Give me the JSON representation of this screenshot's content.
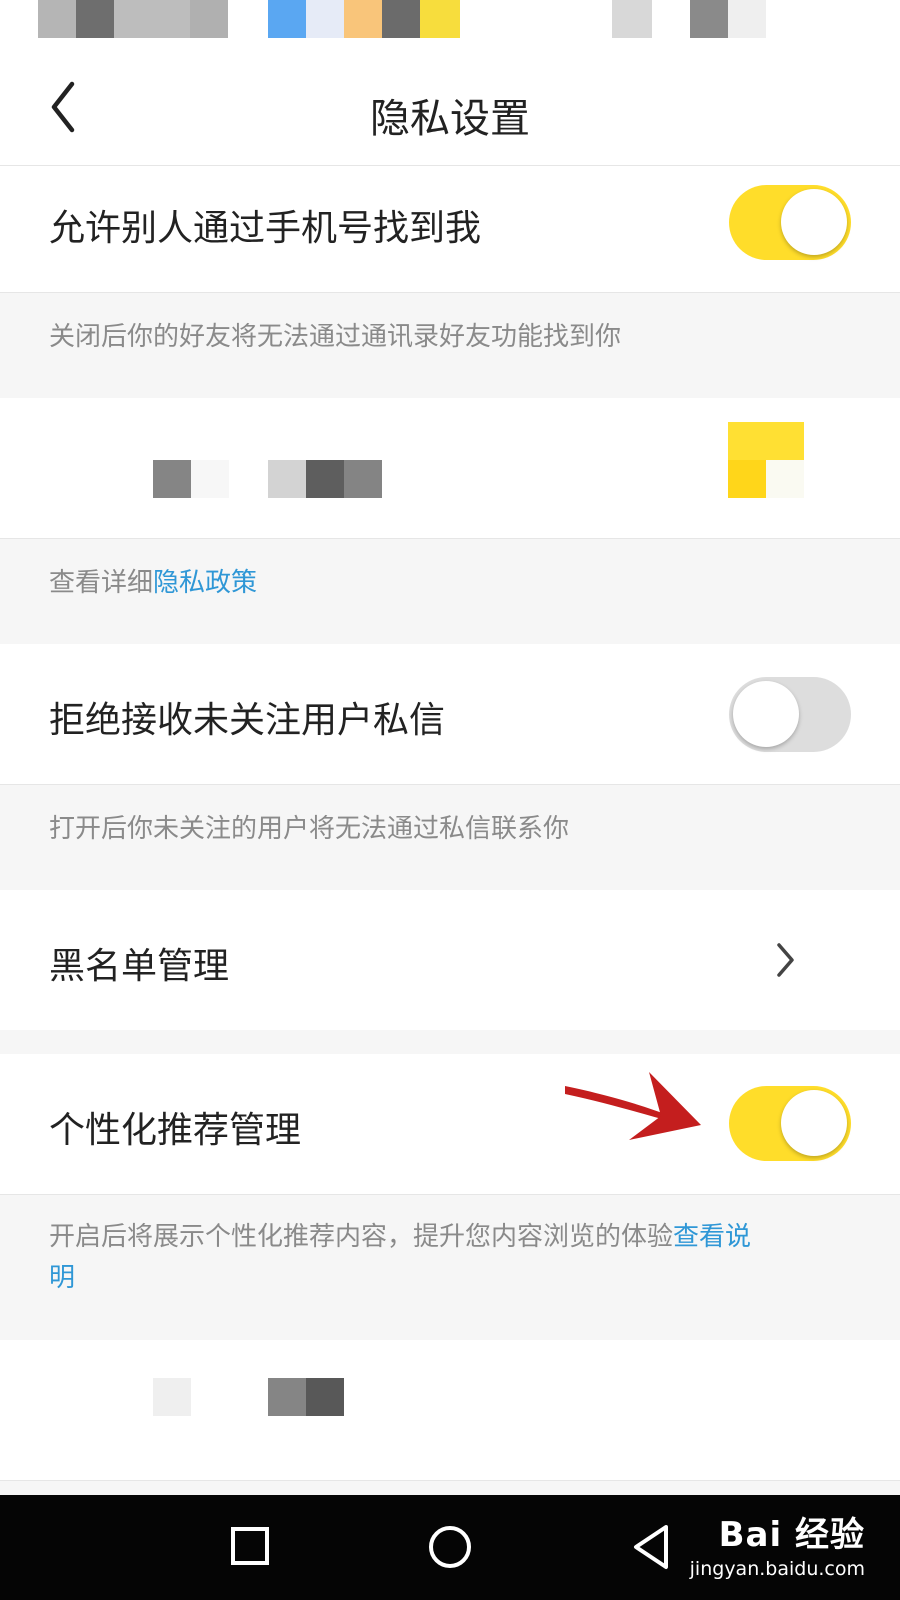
{
  "header": {
    "title": "隐私设置",
    "back_icon": "chevron-left-icon"
  },
  "settings": {
    "find_by_phone": {
      "label": "允许别人通过手机号找到我",
      "enabled": true,
      "description": "关闭后你的好友将无法通过通讯录好友功能找到你"
    },
    "privacy_policy_note": {
      "prefix": "查看详细",
      "link": "隐私政策"
    },
    "reject_messages": {
      "label": "拒绝接收未关注用户私信",
      "enabled": false,
      "description": "打开后你未关注的用户将无法通过私信联系你"
    },
    "blacklist": {
      "label": "黑名单管理",
      "icon": "chevron-right-icon"
    },
    "personalized": {
      "label": "个性化推荐管理",
      "enabled": true,
      "description_line1": "开启后将展示个性化推荐内容，提升您内容浏览的体验",
      "link_part1": "查看说",
      "link_part2": "明"
    }
  },
  "annotation": {
    "arrow_color": "#c41e1e"
  },
  "colors": {
    "toggle_on": "#ffdd2a",
    "toggle_off": "#dddddd",
    "link": "#2f97d6",
    "background": "#f6f6f6"
  },
  "nav": {
    "back_icon": "triangle-back-icon",
    "home_icon": "circle-home-icon",
    "recents_icon": "square-recents-icon"
  },
  "watermark": {
    "main": "Bai 经验",
    "sub": "jingyan.baidu.com"
  }
}
